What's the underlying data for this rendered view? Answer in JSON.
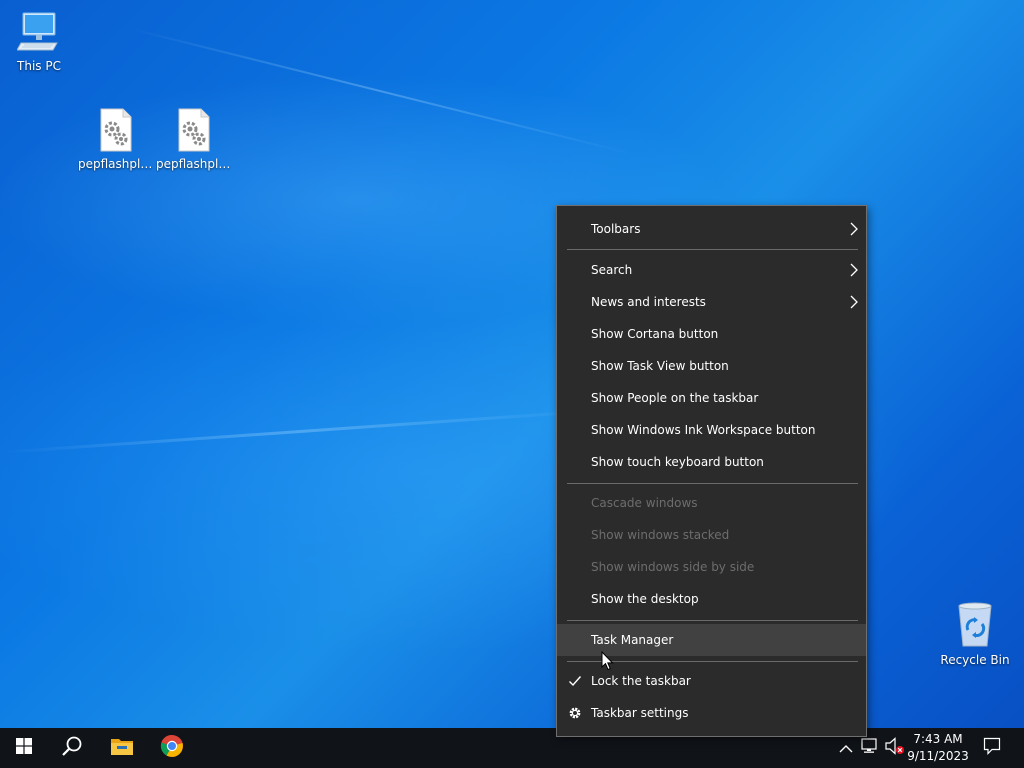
{
  "desktop": {
    "icons": [
      {
        "label": "This PC",
        "icon": "computer-icon"
      },
      {
        "label": "pepflashpla...",
        "icon": "settings-file-icon"
      },
      {
        "label": "pepflashpla...",
        "icon": "settings-file-icon"
      },
      {
        "label": "Recycle Bin",
        "icon": "recycle-bin-icon"
      }
    ]
  },
  "context_menu": {
    "items": [
      {
        "label": "Toolbars",
        "submenu": true
      },
      {
        "label": "Search",
        "submenu": true
      },
      {
        "label": "News and interests",
        "submenu": true
      },
      {
        "label": "Show Cortana button"
      },
      {
        "label": "Show Task View button"
      },
      {
        "label": "Show People on the taskbar"
      },
      {
        "label": "Show Windows Ink Workspace button"
      },
      {
        "label": "Show touch keyboard button"
      },
      {
        "label": "Cascade windows",
        "disabled": true
      },
      {
        "label": "Show windows stacked",
        "disabled": true
      },
      {
        "label": "Show windows side by side",
        "disabled": true
      },
      {
        "label": "Show the desktop"
      },
      {
        "label": "Task Manager",
        "hovered": true
      },
      {
        "label": "Lock the taskbar",
        "checked": true
      },
      {
        "label": "Taskbar settings",
        "icon": "gear-icon"
      }
    ]
  },
  "taskbar": {
    "start_icon": "windows-logo-icon",
    "search_icon": "search-icon",
    "pinned": [
      {
        "name": "File Explorer",
        "icon": "folder-icon"
      },
      {
        "name": "Google Chrome",
        "icon": "chrome-icon"
      }
    ],
    "tray": {
      "icons": [
        "chevron-up-icon",
        "network-icon",
        "volume-muted-icon"
      ],
      "time": "7:43 AM",
      "date": "9/11/2023",
      "notifications_icon": "notification-icon"
    }
  },
  "colors": {
    "menu_bg": "#2b2b2b",
    "menu_hover": "#414141",
    "menu_disabled_text": "#6d6d6d",
    "taskbar_bg": "#101419",
    "desktop_blue": "#0b78e3"
  }
}
